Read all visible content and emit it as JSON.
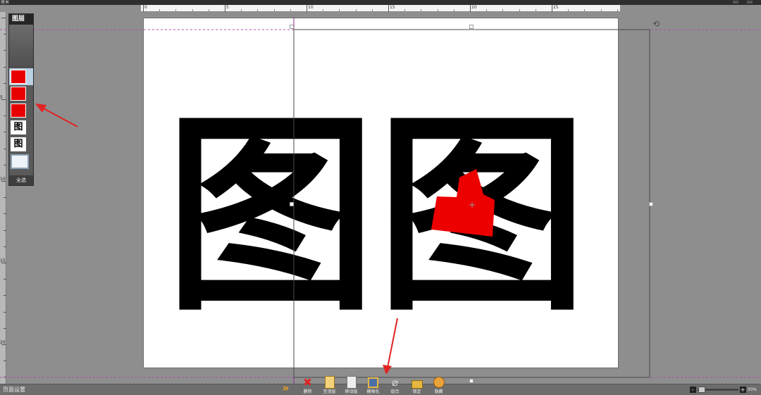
{
  "topbar": {
    "unit_label": "厘米"
  },
  "ruler": {
    "h_labels": [
      "0",
      "5",
      "10",
      "15",
      "20",
      "25"
    ],
    "v_labels": [
      "5",
      "10",
      "15",
      "20"
    ]
  },
  "layers_panel": {
    "title": "图层",
    "items": [
      {
        "type": "red",
        "selected": true
      },
      {
        "type": "red",
        "selected": false
      },
      {
        "type": "red",
        "selected": false
      },
      {
        "type": "glyph",
        "text": "图",
        "selected": false
      },
      {
        "type": "glyph",
        "text": "图",
        "selected": false
      },
      {
        "type": "background",
        "selected": false
      }
    ],
    "select_all_label": "全选"
  },
  "canvas": {
    "glyph_char": "图",
    "colors": {
      "glyph": "#000000",
      "shape": "#ec0000",
      "guide": "#b04fb0",
      "page": "#ffffff"
    }
  },
  "statusbar": {
    "page_settings_label": "页面设置"
  },
  "toolbar": {
    "tools": [
      {
        "name": "collapse-tool",
        "icon": "chevron-down-double-icon",
        "label": ""
      },
      {
        "name": "delete-tool",
        "icon": "delete-icon",
        "label": "删除"
      },
      {
        "name": "bring-to-top-tool",
        "icon": "page-icon",
        "label": "至顶层"
      },
      {
        "name": "move-layer-tool",
        "icon": "page-icon",
        "label": "移动层"
      },
      {
        "name": "rasterize-tool",
        "icon": "rasterize-icon",
        "label": "栅格化"
      },
      {
        "name": "group-tool",
        "icon": "paperclip-icon",
        "label": "组合"
      },
      {
        "name": "lock-tool",
        "icon": "lock-icon",
        "label": "锁定"
      },
      {
        "name": "hide-tool",
        "icon": "hide-icon",
        "label": "隐藏"
      }
    ]
  },
  "zoom": {
    "minus_label": "-",
    "plus_label": "+",
    "percent": "30%"
  },
  "annotations": {
    "arrow_color": "#e02424"
  }
}
